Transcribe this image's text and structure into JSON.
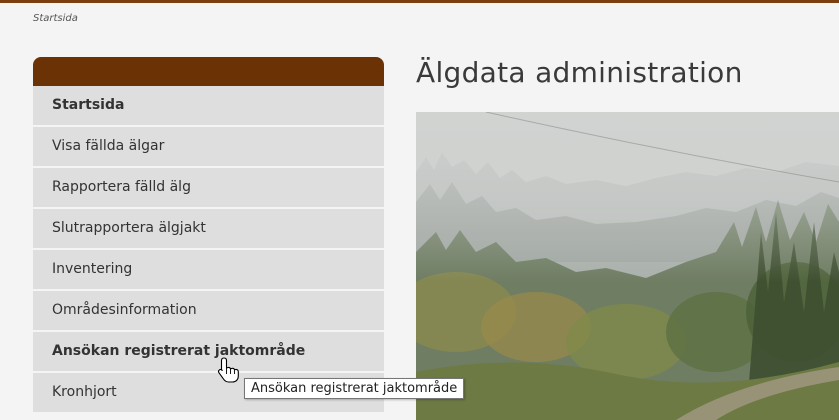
{
  "breadcrumb": "Startsida",
  "page_title": "Älgdata administration",
  "sidebar": {
    "items": [
      {
        "label": "Startsida",
        "bold": true
      },
      {
        "label": "Visa fällda älgar",
        "bold": false
      },
      {
        "label": "Rapportera fälld älg",
        "bold": false
      },
      {
        "label": "Slutrapportera älgjakt",
        "bold": false
      },
      {
        "label": "Inventering",
        "bold": false
      },
      {
        "label": "Områdesinformation",
        "bold": false
      },
      {
        "label": "Ansökan registrerat jaktområde",
        "bold": true
      },
      {
        "label": "Kronhjort",
        "bold": false
      }
    ]
  },
  "tooltip": "Ansökan registrerat jaktområde",
  "colors": {
    "accent_brown": "#6b3206",
    "menu_bg": "#dedede",
    "page_bg": "#f4f4f4"
  },
  "icons": {
    "cursor": "hand-pointer-icon"
  }
}
